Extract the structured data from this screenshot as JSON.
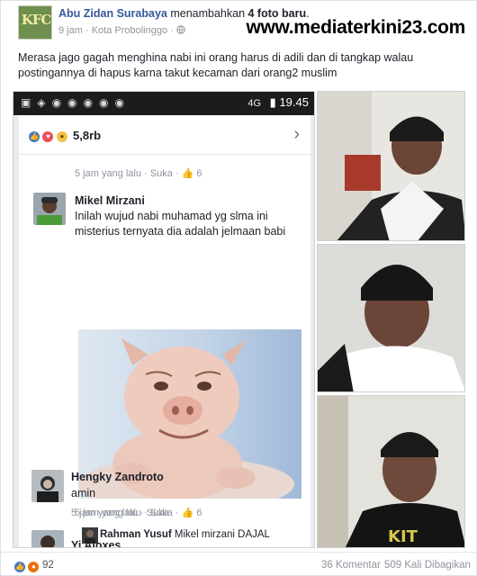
{
  "header": {
    "author": "Abu Zidan Surabaya",
    "action_prefix": " menambahkan ",
    "action_count": "4 foto baru",
    "action_suffix": ".",
    "time": "9 jam",
    "separator": " · ",
    "location": "Kota Probolinggo",
    "dot": " · ",
    "watermark": "www.mediaterkini23.com",
    "avatar_text": "KFC"
  },
  "post": {
    "text": "Merasa jago gagah menghina nabi ini orang harus di adili dan di tangkap walau postingannya di hapus karna takut kecaman dari orang2 muslim"
  },
  "screenshot": {
    "status_time": "19.45",
    "status_signal": "4G",
    "reactions_count": "5,8rb",
    "comments": [
      {
        "meta": "5 jam yang lalu",
        "like": "Suka",
        "likes": "6"
      },
      {
        "name": "Mikel Mirzani",
        "text": "Inilah wujud nabi muhamad yg slma ini misterius ternyata dia adalah jelmaan babi",
        "meta": "5 jam yang lalu",
        "like": "Suka",
        "likes": "6"
      },
      {
        "reply_name": "Rahman Yusuf",
        "reply_text": "Mikel mirzani DAJAL"
      },
      {
        "name": "Hengky Zandroto",
        "text": "amin",
        "meta": "5 jam yang lalu",
        "like": "Suka"
      },
      {
        "name": "Yi Aloxes"
      }
    ]
  },
  "footer": {
    "reaction_count": "92",
    "comments": "36 Komentar",
    "shares": "509 Kali Dibagikan"
  },
  "colors": {
    "link": "#365899",
    "like_blue": "#4a76c4",
    "muted": "#90949c"
  }
}
